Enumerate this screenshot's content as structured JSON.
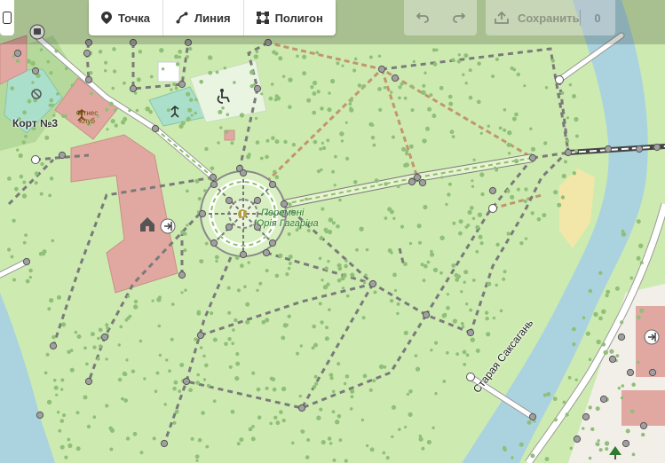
{
  "toolbar": {
    "point_label": "Точка",
    "line_label": "Линия",
    "polygon_label": "Полигон",
    "save_label": "Сохранить",
    "save_count": "0"
  },
  "map_labels": {
    "court": "Корт №3",
    "street": "Старая Саксагань",
    "park_line1": "Перемені",
    "park_line2": "Юрія Гагаріна",
    "fitness": "Фітнес Клуб"
  },
  "colors": {
    "park": "#cdebb0",
    "pitch": "#aae0cb",
    "building": "#e0a8a0",
    "river": "#aad3df",
    "toolbar_bg": "#ffffff"
  },
  "icons": [
    "point-marker-icon",
    "line-tool-icon",
    "polygon-tool-icon",
    "undo-icon",
    "redo-icon",
    "upload-icon",
    "home-icon",
    "entrance-icon",
    "fitness-icon",
    "accessible-icon",
    "bus-stop-icon"
  ]
}
